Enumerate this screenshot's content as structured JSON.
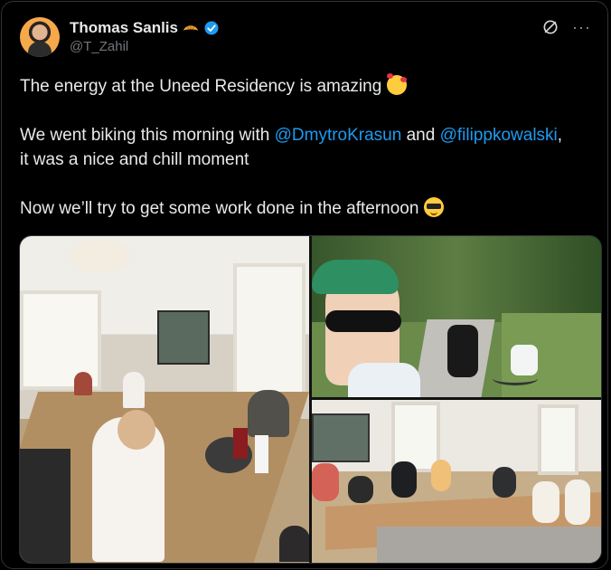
{
  "author": {
    "name": "Thomas Sanlis",
    "handle": "@T_Zahil"
  },
  "icons": {
    "badge": "croissant-icon",
    "verified": "verified-icon",
    "grok": "grok-icon",
    "more": "more-icon"
  },
  "tweet": {
    "line1": "The energy at the Uneed Residency is amazing",
    "line2_prefix": "We went biking this morning with",
    "mention1": "@DmytroKrasun",
    "conj": "and",
    "mention2": "@filippkowalski",
    "line2_suffix": ",",
    "line3": "it was a nice and chill moment",
    "line4": "Now we’ll try to get some work done in the afternoon"
  },
  "colors": {
    "link": "#1d9bf0",
    "text": "#e7e9ea",
    "muted": "#71767b",
    "background": "#000000"
  }
}
